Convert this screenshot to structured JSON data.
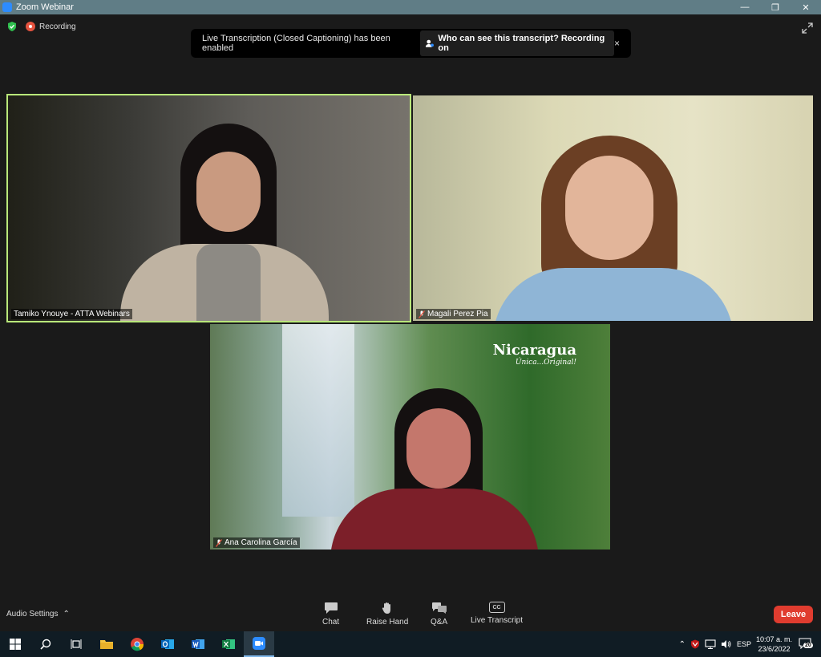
{
  "window": {
    "title": "Zoom Webinar",
    "controls": [
      "—",
      "❐",
      "✕"
    ]
  },
  "status": {
    "recording_label": "Recording"
  },
  "banner": {
    "message": "Live Transcription (Closed Captioning) has been enabled",
    "who_label": "Who can see this transcript? Recording on",
    "close": "×"
  },
  "participants": [
    {
      "name": "Tamiko Ynouye - ATTA Webinars",
      "muted": false,
      "active_speaker": true
    },
    {
      "name": "Magali Perez Pia",
      "muted": true,
      "active_speaker": false
    },
    {
      "name": "Ana Carolina García",
      "muted": true,
      "active_speaker": false
    }
  ],
  "background_brand": {
    "title": "Nicaragua",
    "tagline": "Única...Original!"
  },
  "toolbar": {
    "audio_settings": "Audio Settings",
    "chat": "Chat",
    "raise_hand": "Raise Hand",
    "qa": "Q&A",
    "live_transcript": "Live Transcript",
    "cc_badge": "CC",
    "leave": "Leave"
  },
  "taskbar": {
    "apps": [
      "windows-start",
      "search",
      "task-view",
      "file-explorer",
      "chrome",
      "outlook",
      "word",
      "excel",
      "zoom"
    ],
    "lang": "ESP",
    "time": "10:07 a. m.",
    "date": "23/6/2022",
    "notifications": "20"
  },
  "colors": {
    "active_border": "#b9e87a",
    "leave": "#e03c2f",
    "titlebar": "#607d86"
  }
}
